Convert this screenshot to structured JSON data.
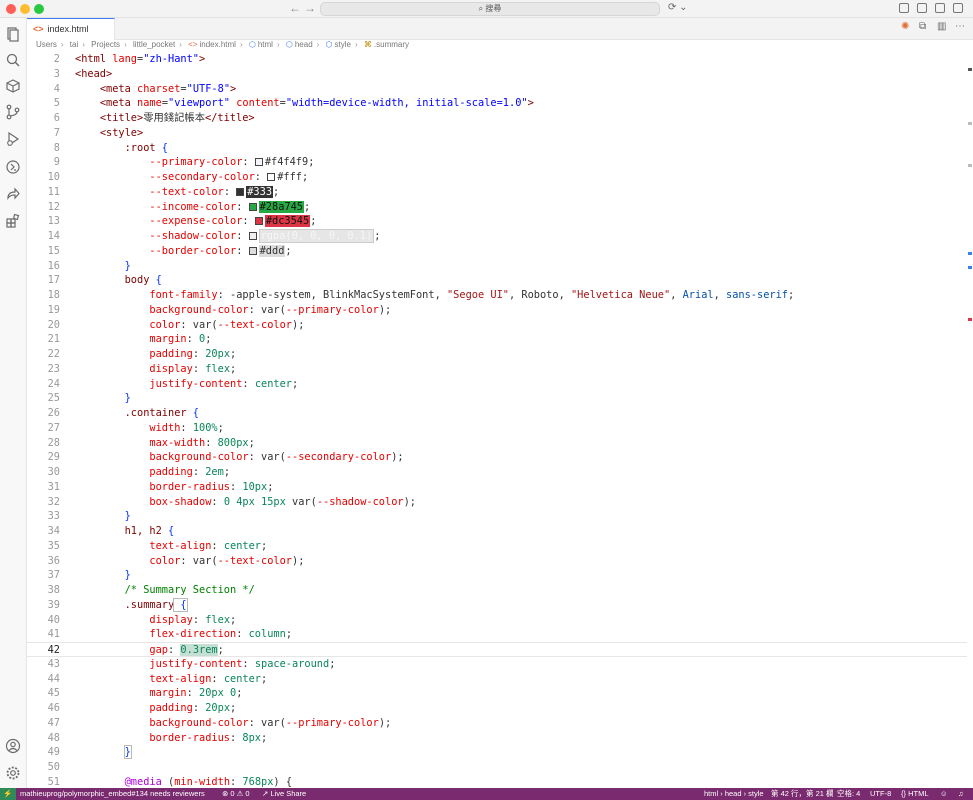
{
  "titlebar": {
    "search_text": "搜尋",
    "back_arrow": "←",
    "forward_arrow": "→",
    "copilot": "⟳ ⌄"
  },
  "tab": {
    "label": "index.html",
    "icon": "<>",
    "close": "×"
  },
  "breadcrumb": {
    "items": [
      "Users",
      "tai",
      "Projects",
      "little_pocket",
      "index.html",
      "html",
      "head",
      "style",
      ".summary"
    ]
  },
  "editor": {
    "current_line": 42,
    "lines": [
      {
        "n": "2"
      },
      {
        "n": "3"
      },
      {
        "n": "4"
      },
      {
        "n": "5"
      },
      {
        "n": "6"
      },
      {
        "n": "7"
      },
      {
        "n": "8"
      },
      {
        "n": "9"
      },
      {
        "n": "10"
      },
      {
        "n": "11"
      },
      {
        "n": "12"
      },
      {
        "n": "13"
      },
      {
        "n": "14"
      },
      {
        "n": "15"
      },
      {
        "n": "16"
      },
      {
        "n": "17"
      },
      {
        "n": "18"
      },
      {
        "n": "19"
      },
      {
        "n": "20"
      },
      {
        "n": "21"
      },
      {
        "n": "22"
      },
      {
        "n": "23"
      },
      {
        "n": "24"
      },
      {
        "n": "25"
      },
      {
        "n": "26"
      },
      {
        "n": "27"
      },
      {
        "n": "28"
      },
      {
        "n": "29"
      },
      {
        "n": "30"
      },
      {
        "n": "31"
      },
      {
        "n": "32"
      },
      {
        "n": "33"
      },
      {
        "n": "34"
      },
      {
        "n": "35"
      },
      {
        "n": "36"
      },
      {
        "n": "37"
      },
      {
        "n": "38"
      },
      {
        "n": "39"
      },
      {
        "n": "40"
      },
      {
        "n": "41"
      },
      {
        "n": "42"
      },
      {
        "n": "43"
      },
      {
        "n": "44"
      },
      {
        "n": "45"
      },
      {
        "n": "46"
      },
      {
        "n": "47"
      },
      {
        "n": "48"
      },
      {
        "n": "49"
      },
      {
        "n": "50"
      },
      {
        "n": "51"
      }
    ],
    "code": {
      "l2": [
        "<html",
        " lang",
        "=",
        "\"zh-Hant\"",
        ">"
      ],
      "l3": "<head>",
      "l4": [
        "<meta",
        " charset",
        "=",
        "\"UTF-8\"",
        ">"
      ],
      "l5": [
        "<meta",
        " name",
        "=",
        "\"viewport\"",
        " content",
        "=",
        "\"width=device-width, initial-scale=1.0\"",
        ">"
      ],
      "l6": [
        "<title>",
        "零用錢記帳本",
        "</title>"
      ],
      "l7": "<style>",
      "l8": [
        ":root",
        " {"
      ],
      "l9": [
        "--primary-color",
        ": ",
        "#f4f4f9",
        ";"
      ],
      "l10": [
        "--secondary-color",
        ": ",
        "#fff",
        ";"
      ],
      "l11": [
        "--text-color",
        ": ",
        "#333",
        ";"
      ],
      "l12": [
        "--income-color",
        ": ",
        "#28a745",
        ";"
      ],
      "l13": [
        "--expense-color",
        ": ",
        "#dc3545",
        ";"
      ],
      "l14": [
        "--shadow-color",
        ": ",
        "rgba(0, 0, 0, 0.1)",
        ";"
      ],
      "l15": [
        "--border-color",
        ": ",
        "#ddd",
        ";"
      ],
      "l16": "}",
      "l17": [
        "body",
        " {"
      ],
      "l18": [
        "font-family",
        ": -apple-system, BlinkMacSystemFont, ",
        "\"Segoe UI\"",
        ", Roboto, ",
        "\"Helvetica Neue\"",
        ", ",
        "Arial",
        ", ",
        "sans-serif",
        ";"
      ],
      "l19": [
        "background-color",
        ": var(",
        "--primary-color",
        ");"
      ],
      "l20": [
        "color",
        ": var(",
        "--text-color",
        ");"
      ],
      "l21": [
        "margin",
        ": ",
        "0",
        ";"
      ],
      "l22": [
        "padding",
        ": ",
        "20px",
        ";"
      ],
      "l23": [
        "display",
        ": ",
        "flex",
        ";"
      ],
      "l24": [
        "justify-content",
        ": ",
        "center",
        ";"
      ],
      "l25": "}",
      "l26": [
        ".container",
        " {"
      ],
      "l27": [
        "width",
        ": ",
        "100%",
        ";"
      ],
      "l28": [
        "max-width",
        ": ",
        "800px",
        ";"
      ],
      "l29": [
        "background-color",
        ": var(",
        "--secondary-color",
        ");"
      ],
      "l30": [
        "padding",
        ": ",
        "2em",
        ";"
      ],
      "l31": [
        "border-radius",
        ": ",
        "10px",
        ";"
      ],
      "l32": [
        "box-shadow",
        ": ",
        "0 4px 15px",
        " var(",
        "--shadow-color",
        ");"
      ],
      "l33": "}",
      "l34": [
        "h1, h2",
        " {"
      ],
      "l35": [
        "text-align",
        ": ",
        "center",
        ";"
      ],
      "l36": [
        "color",
        ": var(",
        "--text-color",
        ");"
      ],
      "l37": "}",
      "l38": "/* Summary Section */",
      "l39": [
        ".summary",
        " {"
      ],
      "l40": [
        "display",
        ": ",
        "flex",
        ";"
      ],
      "l41": [
        "flex-direction",
        ": ",
        "column",
        ";"
      ],
      "l42": [
        "gap",
        ": ",
        "0.3rem",
        ";"
      ],
      "l43": [
        "justify-content",
        ": ",
        "space-around",
        ";"
      ],
      "l44": [
        "text-align",
        ": ",
        "center",
        ";"
      ],
      "l45": [
        "margin",
        ": ",
        "20px 0",
        ";"
      ],
      "l46": [
        "padding",
        ": ",
        "20px",
        ";"
      ],
      "l47": [
        "background-color",
        ": var(",
        "--primary-color",
        ");"
      ],
      "l48": [
        "border-radius",
        ": ",
        "8px",
        ";"
      ],
      "l49": "}",
      "l50": "",
      "l51": [
        "@media",
        " (",
        "min-width",
        ": ",
        "768px",
        ") {"
      ]
    }
  },
  "colors": {
    "primary": "#f4f4f9",
    "secondary": "#fff",
    "text": "#333",
    "income": "#28a745",
    "expense": "#dc3545",
    "shadow": "rgba(0, 0, 0, 0.1)",
    "border": "#ddd",
    "status_bar": "#7a2a6e"
  },
  "statusbar": {
    "remote_icon": "⚡",
    "branch": "mathieuprog/polymorphic_embed#134 needs reviewers",
    "problems": "⊗ 0 ⚠ 0",
    "live_share": "Live Share",
    "breadcrumb": "html › head › style",
    "position": "第 42 行，第 21 欄",
    "indent": "空格: 4",
    "encoding": "UTF-8",
    "eol": "{} HTML"
  }
}
